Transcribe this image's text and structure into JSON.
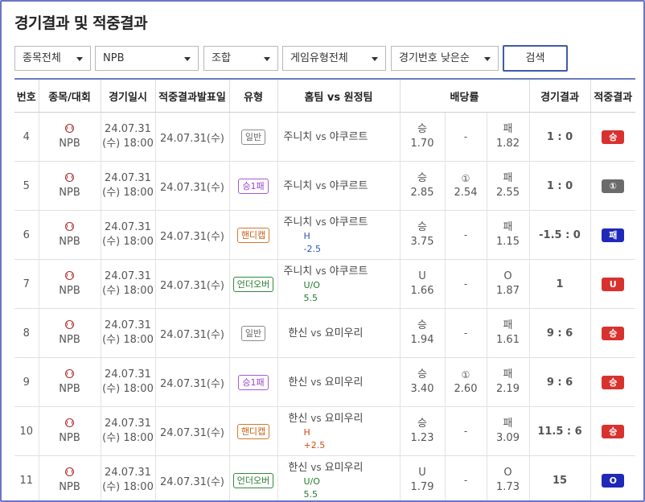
{
  "page": {
    "title": "경기결과 및 적중결과"
  },
  "filters": {
    "sport": "종목전체",
    "league": "NPB",
    "combo": "조합",
    "game_type": "게임유형전체",
    "sort": "경기번호 낮은순",
    "search_label": "검색"
  },
  "table": {
    "headers": {
      "no": "번호",
      "sport": "종목/대회",
      "date": "경기일시",
      "announce": "적중결과발표일",
      "type": "유형",
      "match": "홈팀 vs 원정팀",
      "odds": "배당률",
      "result": "경기결과",
      "hit": "적중결과"
    },
    "vs_label": "vs",
    "rows": [
      {
        "no": "4",
        "league": "NPB",
        "date1": "24.07.31",
        "date2": "(수) 18:00",
        "announce": "24.07.31(수)",
        "type": "일반",
        "type_class": "t-normal",
        "home": "주니치",
        "away": "야쿠르트",
        "sub": "",
        "sub_class": "",
        "o1_lbl": "승",
        "o1": "1.70",
        "o2_lbl": "-",
        "o2": "",
        "o3_lbl": "패",
        "o3": "1.82",
        "score": "1 : 0",
        "hit": "승",
        "hit_class": "r-win"
      },
      {
        "no": "5",
        "league": "NPB",
        "date1": "24.07.31",
        "date2": "(수) 18:00",
        "announce": "24.07.31(수)",
        "type": "승1패",
        "type_class": "t-win1",
        "home": "주니치",
        "away": "야쿠르트",
        "sub": "",
        "sub_class": "",
        "o1_lbl": "승",
        "o1": "2.85",
        "o2_lbl": "①",
        "o2": "2.54",
        "o3_lbl": "패",
        "o3": "2.55",
        "score": "1 : 0",
        "hit": "①",
        "hit_class": "r-draw"
      },
      {
        "no": "6",
        "league": "NPB",
        "date1": "24.07.31",
        "date2": "(수) 18:00",
        "announce": "24.07.31(수)",
        "type": "핸디캡",
        "type_class": "t-handicap",
        "home": "주니치",
        "away": "야쿠르트",
        "sub": "H -2.5",
        "sub_class": "sub-h",
        "o1_lbl": "승",
        "o1": "3.75",
        "o2_lbl": "-",
        "o2": "",
        "o3_lbl": "패",
        "o3": "1.15",
        "score": "-1.5 : 0",
        "hit": "패",
        "hit_class": "r-lose"
      },
      {
        "no": "7",
        "league": "NPB",
        "date1": "24.07.31",
        "date2": "(수) 18:00",
        "announce": "24.07.31(수)",
        "type": "언더오버",
        "type_class": "t-underover",
        "home": "주니치",
        "away": "야쿠르트",
        "sub": "U/O 5.5",
        "sub_class": "sub-uo",
        "o1_lbl": "U",
        "o1": "1.66",
        "o2_lbl": "-",
        "o2": "",
        "o3_lbl": "O",
        "o3": "1.87",
        "score": "1",
        "hit": "U",
        "hit_class": "r-u"
      },
      {
        "no": "8",
        "league": "NPB",
        "date1": "24.07.31",
        "date2": "(수) 18:00",
        "announce": "24.07.31(수)",
        "type": "일반",
        "type_class": "t-normal",
        "home": "한신",
        "away": "요미우리",
        "sub": "",
        "sub_class": "",
        "o1_lbl": "승",
        "o1": "1.94",
        "o2_lbl": "-",
        "o2": "",
        "o3_lbl": "패",
        "o3": "1.61",
        "score": "9 : 6",
        "hit": "승",
        "hit_class": "r-win"
      },
      {
        "no": "9",
        "league": "NPB",
        "date1": "24.07.31",
        "date2": "(수) 18:00",
        "announce": "24.07.31(수)",
        "type": "승1패",
        "type_class": "t-win1",
        "home": "한신",
        "away": "요미우리",
        "sub": "",
        "sub_class": "",
        "o1_lbl": "승",
        "o1": "3.40",
        "o2_lbl": "①",
        "o2": "2.60",
        "o3_lbl": "패",
        "o3": "2.19",
        "score": "9 : 6",
        "hit": "승",
        "hit_class": "r-win"
      },
      {
        "no": "10",
        "league": "NPB",
        "date1": "24.07.31",
        "date2": "(수) 18:00",
        "announce": "24.07.31(수)",
        "type": "핸디캡",
        "type_class": "t-handicap",
        "home": "한신",
        "away": "요미우리",
        "sub": "H +2.5",
        "sub_class": "sub-hp",
        "o1_lbl": "승",
        "o1": "1.23",
        "o2_lbl": "-",
        "o2": "",
        "o3_lbl": "패",
        "o3": "3.09",
        "score": "11.5 : 6",
        "hit": "승",
        "hit_class": "r-win"
      },
      {
        "no": "11",
        "league": "NPB",
        "date1": "24.07.31",
        "date2": "(수) 18:00",
        "announce": "24.07.31(수)",
        "type": "언더오버",
        "type_class": "t-underover",
        "home": "한신",
        "away": "요미우리",
        "sub": "U/O 5.5",
        "sub_class": "sub-uo",
        "o1_lbl": "U",
        "o1": "1.79",
        "o2_lbl": "-",
        "o2": "",
        "o3_lbl": "O",
        "o3": "1.73",
        "score": "15",
        "hit": "O",
        "hit_class": "r-o"
      }
    ]
  },
  "icons": {
    "sport": "baseball-icon",
    "dropdown": "chevron-down-icon"
  },
  "colors": {
    "accent": "#6b74c9",
    "win": "#d8322e",
    "draw": "#6b6b6b",
    "lose": "#1f28b8"
  }
}
